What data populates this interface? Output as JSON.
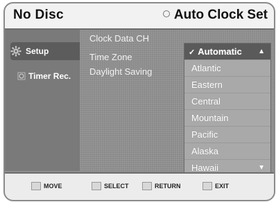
{
  "header": {
    "left_title": "No Disc",
    "right_title": "Auto Clock Set"
  },
  "sidebar": {
    "items": [
      {
        "label": "Setup",
        "icon": "gear-icon",
        "active": true
      },
      {
        "label": "Timer Rec.",
        "icon": "timer-icon",
        "active": false
      }
    ]
  },
  "settings": [
    {
      "label": "Clock Data CH"
    },
    {
      "label": "Time Zone"
    },
    {
      "label": "Daylight Saving"
    }
  ],
  "dropdown": {
    "selected": "Automatic",
    "options": [
      "Atlantic",
      "Eastern",
      "Central",
      "Mountain",
      "Pacific",
      "Alaska",
      "Hawaii"
    ]
  },
  "footer": {
    "move": "MOVE",
    "select": "SELECT",
    "return": "RETURN",
    "exit": "EXIT"
  }
}
